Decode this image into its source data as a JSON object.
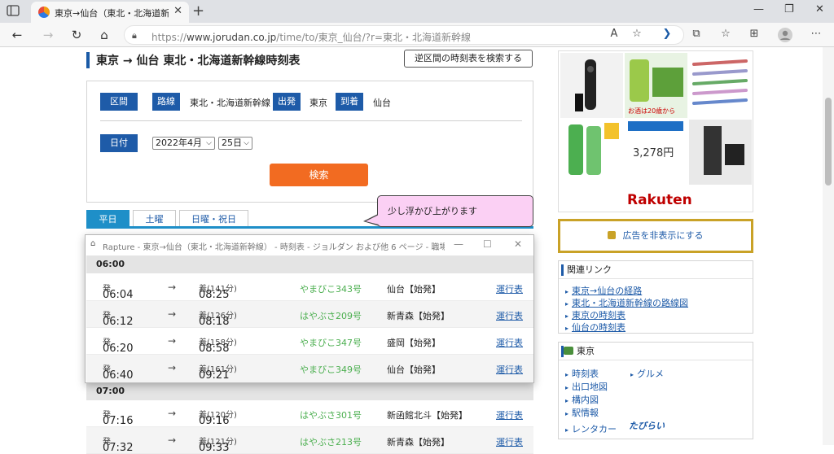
{
  "browser": {
    "tab_title": "東京→仙台（東北・北海道新幹線",
    "url_prefix": "https://",
    "url_main": "www.jorudan.co.jp",
    "url_rest": "/time/to/東京_仙台/?r=東北・北海道新幹線"
  },
  "page": {
    "title": "東京 → 仙台 東北・北海道新幹線時刻表",
    "reverse_button": "逆区間の時刻表を検索する",
    "form": {
      "section_label": "区間",
      "route_label": "路線",
      "route_value": "東北・北海道新幹線",
      "depart_label": "出発",
      "depart_value": "東京",
      "arrive_label": "到着",
      "arrive_value": "仙台",
      "date_label": "日付",
      "month_select": "2022年4月",
      "day_select": "25日",
      "search_button": "検索"
    },
    "day_tabs": [
      "平日",
      "土曜",
      "日曜・祝日"
    ],
    "callout": "少し浮かび上がります",
    "background_table": {
      "hour_7": "07:00",
      "rows": [
        {
          "dep": "07:16",
          "dep_suffix": "発",
          "arr": "09:16",
          "arr_suffix": "着(120分)",
          "train": "はやぶさ301号",
          "dest": "新函館北斗【始発】",
          "link": "運行表"
        },
        {
          "dep": "07:32",
          "dep_suffix": "発",
          "arr": "09:33",
          "arr_suffix": "着(121分)",
          "train": "はやぶさ213号",
          "dest": "新青森【始発】",
          "link": "運行表"
        }
      ]
    }
  },
  "rapture_window": {
    "title": "Rapture - 東京→仙台（東北・北海道新幹線） - 時刻表 - ジョルダン および他 6 ページ - 職場 - Micros...",
    "hour": "06:00",
    "rows": [
      {
        "dep": "06:04",
        "dep_suffix": "発",
        "arr": "08:25",
        "arr_suffix": "着(141分)",
        "train": "やまびこ343号",
        "dest": "仙台【始発】",
        "link": "運行表"
      },
      {
        "dep": "06:12",
        "dep_suffix": "発",
        "arr": "08:18",
        "arr_suffix": "着(126分)",
        "train": "はやぶさ209号",
        "dest": "新青森【始発】",
        "link": "運行表"
      },
      {
        "dep": "06:20",
        "dep_suffix": "発",
        "arr": "08:58",
        "arr_suffix": "着(158分)",
        "train": "やまびこ347号",
        "dest": "盛岡【始発】",
        "link": "運行表"
      },
      {
        "dep": "06:40",
        "dep_suffix": "発",
        "arr": "09:21",
        "arr_suffix": "着(161分)",
        "train": "やまびこ349号",
        "dest": "仙台【始発】",
        "link": "運行表"
      }
    ]
  },
  "sidebar": {
    "ad_price": "3,278円",
    "ad_note": "お酒は20歳から",
    "ad_brand": "Rakuten",
    "hide_ad": "広告を非表示にする",
    "related": {
      "heading": "関連リンク",
      "links": [
        "東京→仙台の経路",
        "東北・北海道新幹線の路線図",
        "東京の時刻表",
        "仙台の時刻表"
      ]
    },
    "station": {
      "heading": "東京",
      "links": [
        "時刻表",
        "グルメ",
        "出口地図",
        "構内図",
        "駅情報",
        "レンタカー"
      ],
      "rental_brand": "たびらい"
    }
  },
  "colors": {
    "accent": "#1e5ba8",
    "search": "#f26b21",
    "callout": "#fbd0f4",
    "train_green": "#4caf50"
  }
}
